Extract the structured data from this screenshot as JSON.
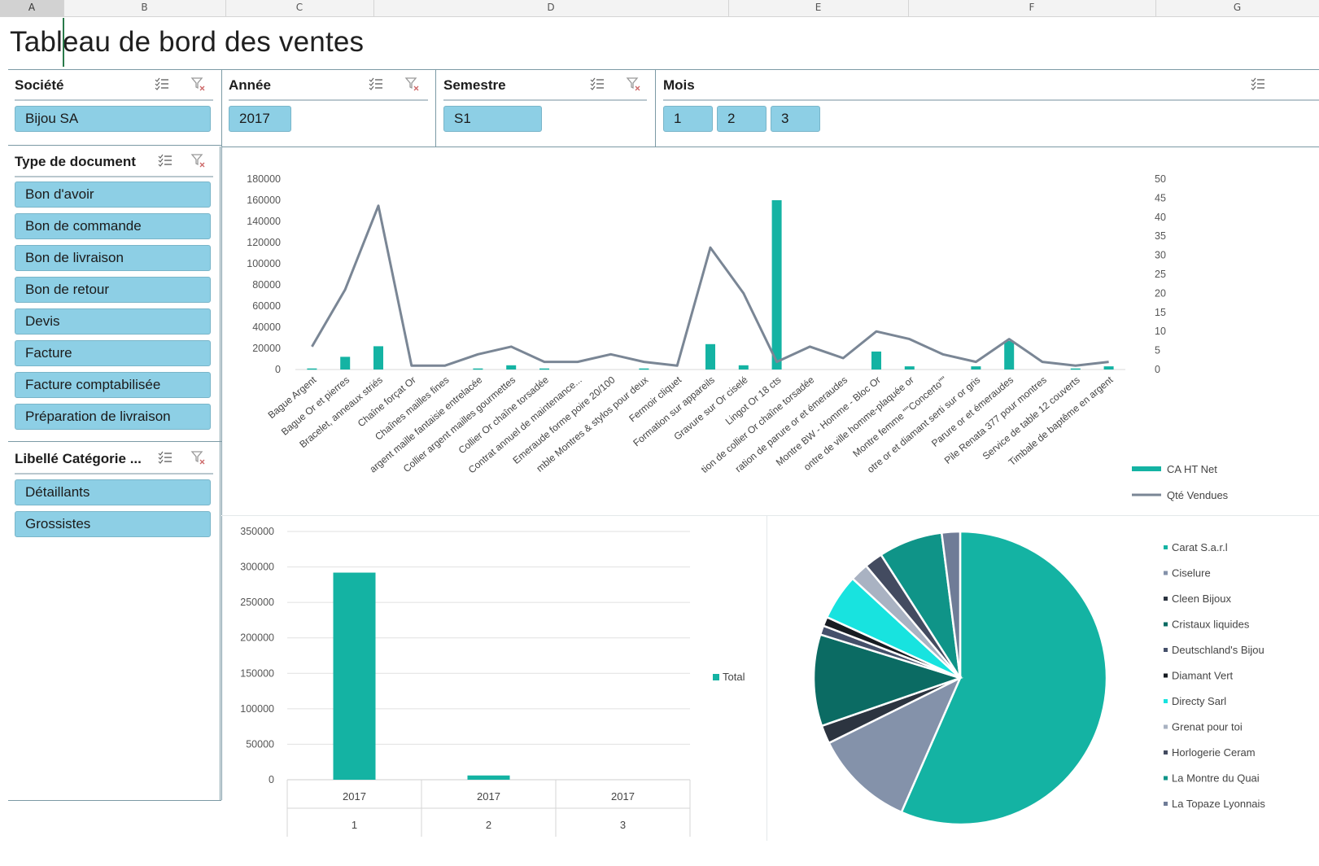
{
  "sheet": {
    "columns": [
      "A",
      "B",
      "C",
      "D",
      "E",
      "F",
      "G"
    ],
    "selected_column": "A",
    "title": "Tableau de bord des ventes"
  },
  "slicers": {
    "societe": {
      "title": "Société",
      "items": [
        "Bijou SA"
      ]
    },
    "annee": {
      "title": "Année",
      "items": [
        "2017"
      ]
    },
    "semestre": {
      "title": "Semestre",
      "items": [
        "S1"
      ]
    },
    "mois": {
      "title": "Mois",
      "items": [
        "1",
        "2",
        "3"
      ]
    },
    "type_document": {
      "title": "Type de document",
      "items": [
        "Bon d'avoir",
        "Bon de commande",
        "Bon de livraison",
        "Bon de retour",
        "Devis",
        "Facture",
        "Facture comptabilisée",
        "Préparation de livraison"
      ]
    },
    "categorie": {
      "title": "Libellé Catégorie ...",
      "items": [
        "Détaillants",
        "Grossistes"
      ]
    }
  },
  "icons": {
    "multiselect": "multi-select-icon",
    "clear_filter": "clear-filter-icon"
  },
  "colors": {
    "teal": "#14b3a3",
    "slate": "#7a8695",
    "slicer_item": "#8dcfe5",
    "frame": "#7c9aa5"
  },
  "chart_data": [
    {
      "type": "combo-bar-line",
      "categories": [
        "Bague Argent",
        "Bague Or et pierres",
        "Bracelet, anneaux striés",
        "Chaîne forçat Or",
        "Chaînes mailles fines",
        "argent maille fantaisie entrelacée",
        "Collier argent mailles gourmettes",
        "Collier Or chaîne torsadée",
        "Contrat annuel de maintenance...",
        "Emeraude forme poire 20/100",
        "mble Montres & stylos pour deux",
        "Fermoir cliquet",
        "Formation sur appareils",
        "Gravure sur Or ciselé",
        "Lingot Or 18 cts",
        "tion de collier Or chaîne torsadée",
        "ration de parure or et émeraudes",
        "Montre BW - Homme - Bloc Or",
        "ontre de ville homme-plaquée or",
        "Montre femme \"\"Concerto\"\"",
        "otre or et diamant serti sur or gris",
        "Parure or et émeraudes",
        "Pile Renata 377 pour montres",
        "Service de table 12 couverts",
        "Timbale de baptême en argent"
      ],
      "series": [
        {
          "name": "CA HT Net",
          "axis": "left",
          "type": "bar",
          "values": [
            1000,
            12000,
            22000,
            0,
            0,
            1000,
            4000,
            1000,
            0,
            0,
            1000,
            0,
            24000,
            4000,
            160000,
            0,
            0,
            17000,
            3000,
            0,
            3000,
            27000,
            0,
            1000,
            3000
          ]
        },
        {
          "name": "Qté Vendues",
          "axis": "right",
          "type": "line",
          "values": [
            6,
            21,
            43,
            1,
            1,
            4,
            6,
            2,
            2,
            4,
            2,
            1,
            32,
            20,
            2,
            6,
            3,
            10,
            8,
            4,
            2,
            8,
            2,
            1,
            2
          ]
        }
      ],
      "y_left_ticks": [
        0,
        20000,
        40000,
        60000,
        80000,
        100000,
        120000,
        140000,
        160000,
        180000
      ],
      "y_right_ticks": [
        0,
        5,
        10,
        15,
        20,
        25,
        30,
        35,
        40,
        45,
        50
      ],
      "ylim_left": [
        0,
        180000
      ],
      "ylim_right": [
        0,
        50
      ],
      "legend_position": "bottom-right"
    },
    {
      "type": "bar",
      "categories": [
        [
          "2017",
          "1"
        ],
        [
          "2017",
          "2"
        ],
        [
          "2017",
          "3"
        ]
      ],
      "series": [
        {
          "name": "Total",
          "values": [
            292000,
            6000,
            0
          ]
        }
      ],
      "y_ticks": [
        0,
        50000,
        100000,
        150000,
        200000,
        250000,
        300000,
        350000
      ],
      "ylim": [
        0,
        350000
      ],
      "legend_position": "right"
    },
    {
      "type": "pie",
      "labels": [
        "Carat S.a.r.l",
        "Ciselure",
        "Cleen Bijoux",
        "Cristaux liquides",
        "Deutschland's Bijou",
        "Diamant Vert",
        "Directy Sarl",
        "Grenat pour toi",
        "Horlogerie Ceram",
        "La Montre du Quai",
        "La Topaze Lyonnais"
      ],
      "values": [
        56,
        11,
        2,
        10,
        1,
        1,
        5,
        2,
        2,
        7,
        2
      ],
      "colors": [
        "#14b3a3",
        "#8492aa",
        "#2c3440",
        "#0b6b63",
        "#45506a",
        "#171c22",
        "#18e3df",
        "#a9b2c2",
        "#434b60",
        "#0f9488",
        "#6f7c97"
      ],
      "legend_position": "right"
    }
  ]
}
